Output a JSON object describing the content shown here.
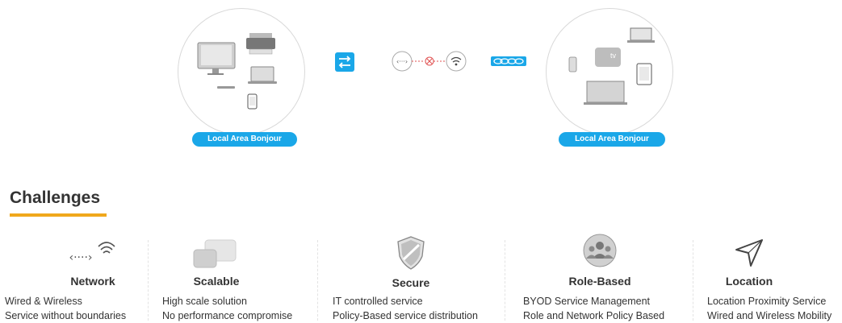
{
  "diagram": {
    "left_label": "Local Area Bonjour",
    "right_label": "Local Area Bonjour",
    "apple_tv_text": "tv"
  },
  "challenges": {
    "title": "Challenges",
    "items": [
      {
        "title": "Network",
        "lines": [
          "Wired & Wireless",
          "Service without boundaries"
        ],
        "icon": "network-wifi-icon"
      },
      {
        "title": "Scalable",
        "lines": [
          "High scale solution",
          "No performance compromise"
        ],
        "icon": "scalable-blocks-icon"
      },
      {
        "title": "Secure",
        "lines": [
          "IT controlled service",
          "Policy-Based service distribution"
        ],
        "icon": "shield-icon"
      },
      {
        "title": "Role-Based",
        "lines": [
          "BYOD Service Management",
          "Role and Network Policy Based"
        ],
        "icon": "user-group-icon"
      },
      {
        "title": "Location",
        "lines": [
          "Location Proximity Service",
          "Wired and Wireless Mobility"
        ],
        "icon": "location-arrow-icon"
      }
    ]
  },
  "colors": {
    "accent_blue": "#1aa7e8",
    "underline_orange": "#f0a81c",
    "error_red": "#e05050"
  }
}
